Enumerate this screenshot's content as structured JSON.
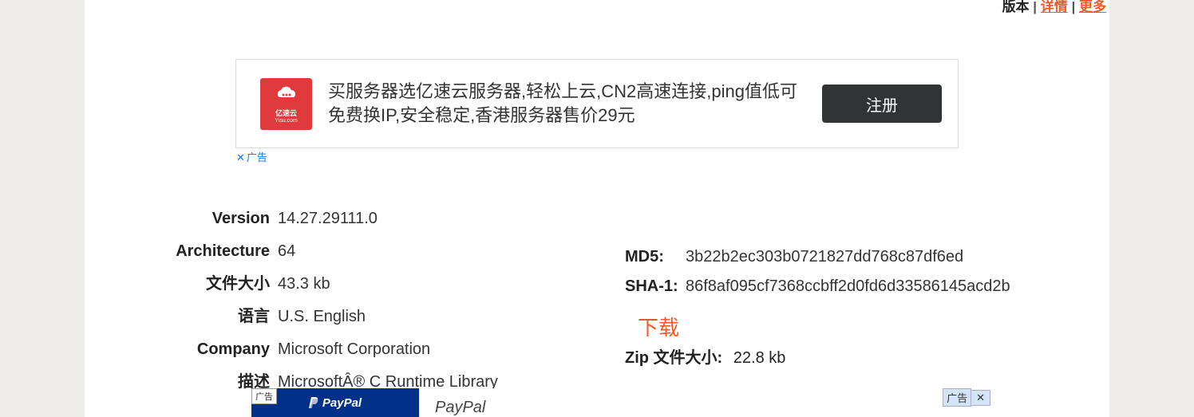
{
  "top_links": {
    "prefix_partial": "版本",
    "sep": " | ",
    "link1": "详情",
    "link2": "更多"
  },
  "ad1": {
    "logo_name": "亿速云",
    "logo_sub": "Yisu.com",
    "text": "买服务器选亿速云服务器,轻松上云,CN2高速连接,ping值低可免费换IP,安全稳定,香港服务器售价29元",
    "button": "注册",
    "marker": "广告"
  },
  "left": {
    "version_label": "Version",
    "version_value": "14.27.29111.0",
    "arch_label": "Architecture",
    "arch_value": "64",
    "filesize_label": "文件大小",
    "filesize_value": "43.3 kb",
    "lang_label": "语言",
    "lang_value": "U.S. English",
    "company_label": "Company",
    "company_value": "Microsoft Corporation",
    "desc_label": "描述",
    "desc_value": "MicrosoftÂ® C Runtime Library"
  },
  "right": {
    "md5_label": "MD5:",
    "md5_value": "3b22b2ec303b0721827dd768c87df6ed",
    "sha1_label": "SHA-1:",
    "sha1_value": "86f8af095cf7368ccbff2d0fd6d33586145acd2b",
    "download_header": "下载",
    "zip_label": "Zip 文件大小:",
    "zip_value": "22.8 kb"
  },
  "ad2": {
    "tag": "广告",
    "brand": "PayPal",
    "title": "PayPal",
    "close_tag": "广告",
    "close_x": "✕"
  }
}
